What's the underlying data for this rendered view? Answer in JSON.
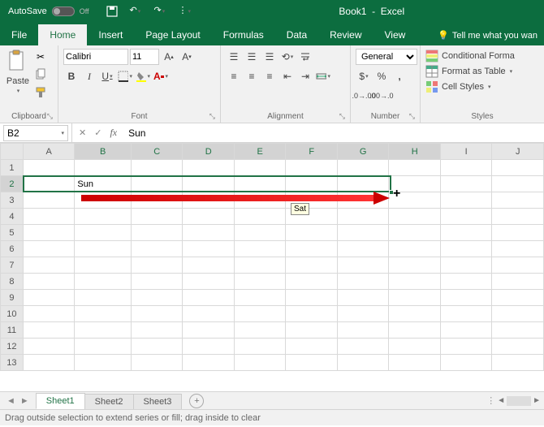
{
  "title": {
    "autosave": "AutoSave",
    "autosave_state": "Off",
    "document": "Book1",
    "app": "Excel"
  },
  "qat": [
    "save",
    "undo",
    "redo",
    "touch-mode"
  ],
  "tabs": {
    "items": [
      "File",
      "Home",
      "Insert",
      "Page Layout",
      "Formulas",
      "Data",
      "Review",
      "View"
    ],
    "active": "Home",
    "tell_me": "Tell me what you wan"
  },
  "ribbon": {
    "clipboard": {
      "label": "Clipboard",
      "paste": "Paste"
    },
    "font": {
      "label": "Font",
      "name": "Calibri",
      "size": "11"
    },
    "alignment": {
      "label": "Alignment"
    },
    "number": {
      "label": "Number",
      "format": "General"
    },
    "styles": {
      "label": "Styles",
      "conditional": "Conditional Forma",
      "table": "Format as Table",
      "cell": "Cell Styles"
    }
  },
  "formula_bar": {
    "cell_ref": "B2",
    "value": "Sun"
  },
  "grid": {
    "columns": [
      "A",
      "B",
      "C",
      "D",
      "E",
      "F",
      "G",
      "H",
      "I",
      "J"
    ],
    "rows": 13,
    "cells": {
      "B2": "Sun"
    },
    "fill_tooltip": "Sat",
    "selected_cols": [
      "B",
      "C",
      "D",
      "E",
      "F",
      "G",
      "H"
    ],
    "selected_row": 2
  },
  "sheets": {
    "items": [
      "Sheet1",
      "Sheet2",
      "Sheet3"
    ],
    "active": "Sheet1"
  },
  "status": "Drag outside selection to extend series or fill; drag inside to clear"
}
